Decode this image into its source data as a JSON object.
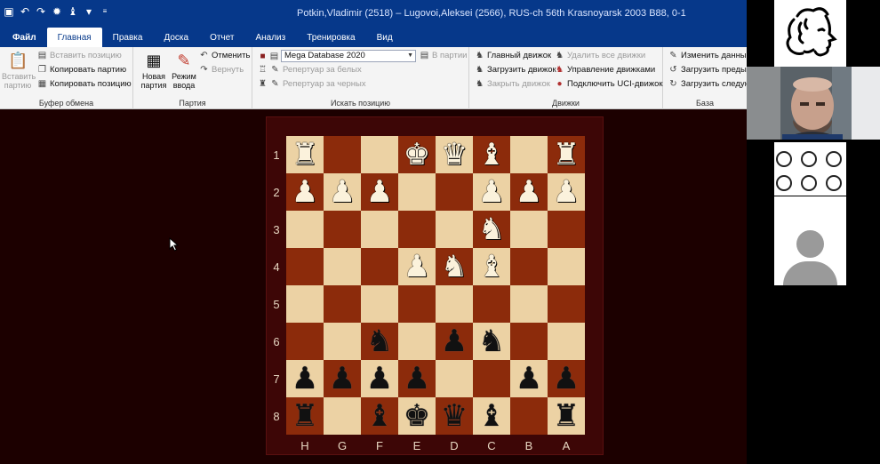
{
  "window": {
    "title": "Potkin,Vladimir (2518) – Lugovoi,Aleksei (2566), RUS-ch 56th Krasnoyarsk 2003   B88, 0-1"
  },
  "quick_access": [
    "save-icon",
    "undo-icon",
    "redo-icon",
    "settings-icon",
    "piece-icon",
    "filter-icon",
    "dropdown-icon"
  ],
  "menu": {
    "tabs": [
      "Файл",
      "Главная",
      "Правка",
      "Доска",
      "Отчет",
      "Анализ",
      "Тренировка",
      "Вид"
    ],
    "active": "Главная"
  },
  "ribbon": {
    "clipboard": {
      "caption": "Буфер обмена",
      "paste_game": "Вставить партию",
      "paste_position": "Вставить позицию",
      "copy_game": "Копировать партию",
      "copy_position": "Копировать позицию"
    },
    "game": {
      "caption": "Партия",
      "new_game": "Новая партия",
      "input_mode": "Режим ввода",
      "undo": "Отменить",
      "redo": "Вернуть"
    },
    "search": {
      "caption": "Искать позицию",
      "database": "Mega Database 2020",
      "in_games": "В партии",
      "white_rep": "Репертуар за белых",
      "black_rep": "Репертуар за черных"
    },
    "engines": {
      "caption": "Движки",
      "main_engine": "Главный движок",
      "load_engine": "Загрузить движок",
      "close_engine": "Закрыть движок",
      "remove_all": "Удалить все движки",
      "manage": "Управление движками",
      "uci": "Подключить UCI-движок"
    },
    "base": {
      "caption": "База",
      "edit_data": "Изменить данные",
      "load_prev": "Загрузить предыд",
      "load_next": "Загрузить следую"
    }
  },
  "board": {
    "light": "#ecd2a4",
    "dark": "#8c2b0b",
    "ranks": [
      "1",
      "2",
      "3",
      "4",
      "5",
      "6",
      "7",
      "8"
    ],
    "files": [
      "H",
      "G",
      "F",
      "E",
      "D",
      "C",
      "B",
      "A"
    ],
    "rows": [
      [
        "♜w",
        "",
        "",
        "♚w",
        "♛w",
        "♝w",
        "",
        "♜w"
      ],
      [
        "♟w",
        "♟w",
        "♟w",
        "",
        "",
        "♟w",
        "♟w",
        "♟w"
      ],
      [
        "",
        "",
        "",
        "",
        "",
        "♞w",
        "",
        ""
      ],
      [
        "",
        "",
        "",
        "♟w",
        "♞w",
        "♝w",
        "",
        ""
      ],
      [
        "",
        "",
        "",
        "",
        "",
        "",
        "",
        ""
      ],
      [
        "",
        "",
        "♞b",
        "",
        "♟b",
        "♞b",
        "",
        ""
      ],
      [
        "♟b",
        "♟b",
        "♟b",
        "♟b",
        "",
        "",
        "♟b",
        "♟b"
      ],
      [
        "♜b",
        "",
        "♝b",
        "♚b",
        "♛b",
        "♝b",
        "",
        "♜b"
      ]
    ]
  },
  "conference": {
    "logo_icon": "pushkin-portrait-icon",
    "avatar_icon": "user-avatar-icon"
  }
}
